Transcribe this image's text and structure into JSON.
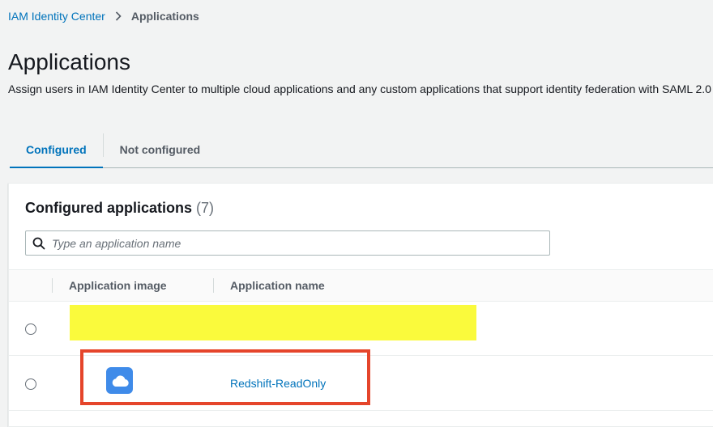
{
  "breadcrumb": {
    "parent": "IAM Identity Center",
    "current": "Applications"
  },
  "page": {
    "title": "Applications",
    "description": "Assign users in IAM Identity Center to multiple cloud applications and any custom applications that support identity federation with SAML 2.0"
  },
  "tabs": [
    {
      "label": "Configured",
      "active": true
    },
    {
      "label": "Not configured",
      "active": false
    }
  ],
  "panel": {
    "title": "Configured applications",
    "count": "(7)"
  },
  "search": {
    "placeholder": "Type an application name",
    "value": ""
  },
  "table": {
    "columns": [
      "Application image",
      "Application name"
    ],
    "rows": [
      {
        "redacted": true,
        "name": ""
      },
      {
        "redacted": false,
        "icon": "cloud-icon",
        "name": "Redshift-ReadOnly"
      }
    ]
  },
  "colors": {
    "accent": "#0073bb",
    "app_icon": "#3f8be9",
    "redaction": "#fafa3c",
    "highlight": "#e5452b"
  }
}
